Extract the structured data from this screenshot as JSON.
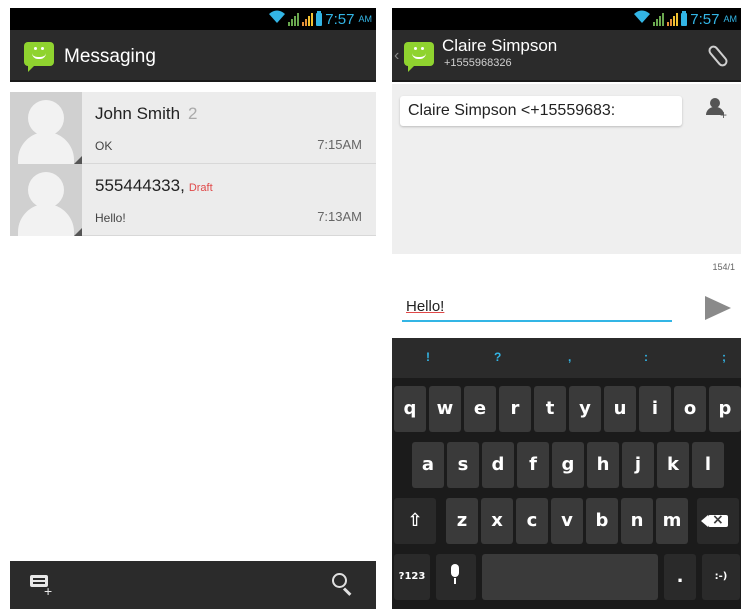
{
  "colors": {
    "accent": "#33b5e5",
    "actionbar": "#2b2b2b",
    "draft": "#e04848",
    "messaging_icon": "#8fd32f"
  },
  "status": {
    "time": "7:57",
    "ampm": "AM"
  },
  "left": {
    "title": "Messaging",
    "conversations": [
      {
        "name": "John Smith",
        "count": "2",
        "draft": "",
        "snippet": "OK",
        "time": "7:15AM"
      },
      {
        "name": "555444333,",
        "count": "",
        "draft": "Draft",
        "snippet": "Hello!",
        "time": "7:13AM"
      }
    ],
    "bottom_icons": [
      "compose-new-icon",
      "search-icon"
    ]
  },
  "right": {
    "contact_name": "Claire Simpson",
    "contact_number": "+1555968326",
    "recipient": "Claire Simpson <+15559683:",
    "char_count": "154/1",
    "message": "Hello!",
    "suggestions": [
      "!",
      "?",
      ",",
      ":",
      ";"
    ],
    "keyboard": {
      "row1": [
        {
          "key": "q",
          "hint": ""
        },
        {
          "key": "w",
          "hint": ""
        },
        {
          "key": "e",
          "hint": ""
        },
        {
          "key": "r",
          "hint": ""
        },
        {
          "key": "t",
          "hint": ""
        },
        {
          "key": "y",
          "hint": ""
        },
        {
          "key": "u",
          "hint": ""
        },
        {
          "key": "i",
          "hint": ""
        },
        {
          "key": "o",
          "hint": ""
        },
        {
          "key": "p",
          "hint": ""
        }
      ],
      "row2": [
        "a",
        "s",
        "d",
        "f",
        "g",
        "h",
        "j",
        "k",
        "l"
      ],
      "row3": [
        "z",
        "x",
        "c",
        "v",
        "b",
        "n",
        "m"
      ],
      "symbols_key": "?123",
      "period_key": ".",
      "smiley_key": ":-)"
    }
  }
}
